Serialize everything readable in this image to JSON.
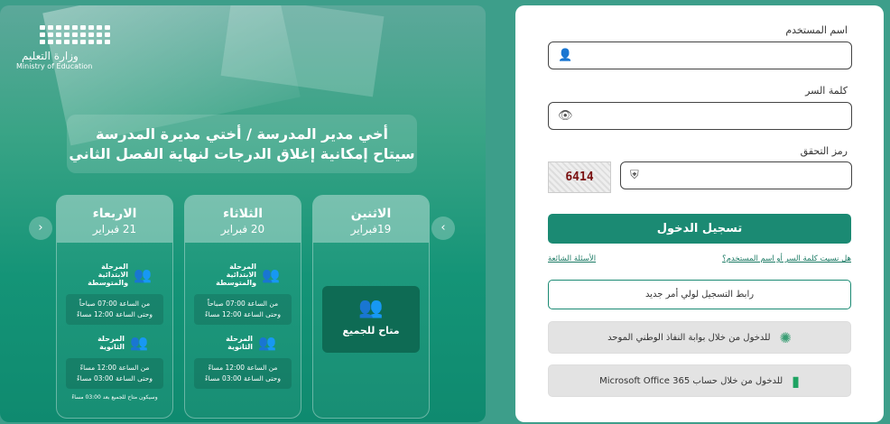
{
  "logo": {
    "ar": "وزارة التعليم",
    "en": "Ministry of Education"
  },
  "headline": {
    "line1": "أخي مدير المدرسة / أختي مديرة المدرسة",
    "line2": "سيتاح إمكانية إغلاق الدرجات لنهاية الفصل الثاني"
  },
  "days": [
    {
      "name": "الاثنين",
      "date": "19فبراير",
      "all_label": "متاح للجميع"
    },
    {
      "name": "الثلاثاء",
      "date": "20 فبراير",
      "stage1": "المرحلة الابتدائية والمتوسطة",
      "time1a": "من الساعة 07:00 صباحاً",
      "time1b": "وحتى الساعة 12:00 مساءً",
      "stage2": "المرحلة الثانوية",
      "time2a": "من الساعة 12:00 مساءً",
      "time2b": "وحتى الساعة 03:00 مساءً"
    },
    {
      "name": "الاربعاء",
      "date": "21 فبراير",
      "stage1": "المرحلة الابتدائية والمتوسطة",
      "time1a": "من الساعة 07:00 صباحاً",
      "time1b": "وحتى الساعة 12:00 مساءً",
      "stage2": "المرحلة الثانوية",
      "time2a": "من الساعة 12:00 مساءً",
      "time2b": "وحتى الساعة 03:00 مساءً",
      "note": "وسيكون متاح للجميع بعد 03:00 مساءً"
    }
  ],
  "arrows": {
    "prev": "‹",
    "next": "›"
  },
  "form": {
    "username_label": "اسم المستخدم",
    "password_label": "كلمة السر",
    "captcha_label": "رمز التحقق",
    "captcha_code": "6414",
    "login_button": "تسجيل الدخول",
    "forgot_link": "هل نسيت كلمة السر أو اسم المستخدم؟",
    "faq_link": "الأسئلة الشائعة",
    "parent_register": "رابط التسجيل لولي أمر جديد",
    "nafath_login": "للدخول من خلال بوابة النفاذ الوطني الموحد",
    "office_login": "للدخول من خلال حساب Microsoft Office 365"
  },
  "icons": {
    "user": "user-icon",
    "eye": "eye-icon",
    "shield": "shield-icon",
    "group": "group-icon",
    "nafath": "nafath-icon",
    "office": "office-icon"
  },
  "colors": {
    "primary": "#1b8a73",
    "banner": "#149477"
  }
}
